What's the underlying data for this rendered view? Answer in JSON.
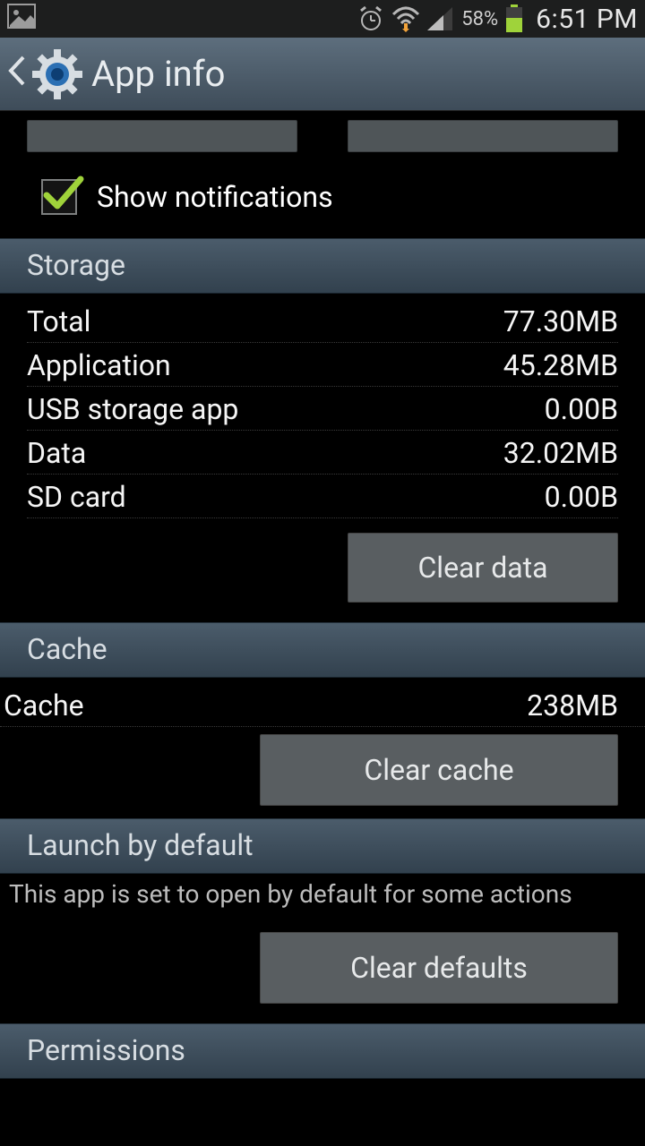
{
  "status": {
    "battery_pct": "58%",
    "time": "6:51 PM"
  },
  "header": {
    "title": "App info"
  },
  "notifications": {
    "show_label": "Show notifications",
    "checked": true
  },
  "sections": {
    "storage": {
      "title": "Storage",
      "rows": [
        {
          "label": "Total",
          "value": "77.30MB"
        },
        {
          "label": "Application",
          "value": "45.28MB"
        },
        {
          "label": "USB storage app",
          "value": "0.00B"
        },
        {
          "label": "Data",
          "value": "32.02MB"
        },
        {
          "label": "SD card",
          "value": "0.00B"
        }
      ],
      "button": "Clear data"
    },
    "cache": {
      "title": "Cache",
      "rows": [
        {
          "label": "Cache",
          "value": "238MB"
        }
      ],
      "button": "Clear cache"
    },
    "launch": {
      "title": "Launch by default",
      "desc": "This app is set to open by default for some actions",
      "button": "Clear defaults"
    },
    "permissions": {
      "title": "Permissions"
    }
  }
}
